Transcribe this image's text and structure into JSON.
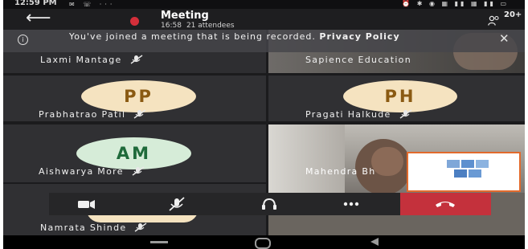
{
  "status_bar": {
    "time": "12:59 PM"
  },
  "header": {
    "title": "Meeting",
    "duration": "16:58",
    "attendees": "21 attendees",
    "participants_count": "20+"
  },
  "banner": {
    "text_prefix": "You've joined a meeting that is being recorded.",
    "link_label": "Privacy Policy"
  },
  "participants": [
    {
      "name": "Laxmi Mantage"
    },
    {
      "name": "Sapience Education"
    },
    {
      "name": "Prabhatrao Patil",
      "initials": "PP",
      "avatar_color": "#f5e3c0",
      "initials_color": "#8a5a12"
    },
    {
      "name": "Pragati Halkude",
      "initials": "PH",
      "avatar_color": "#f5e3c0",
      "initials_color": "#8a5a12"
    },
    {
      "name": "Aishwarya More",
      "initials": "AM",
      "avatar_color": "#d6ecd8",
      "initials_color": "#1f6a3a"
    },
    {
      "name": "Mahendra Bh"
    },
    {
      "name": "Namrata Shinde",
      "avatar_color": "#f5e3c0"
    }
  ],
  "colors": {
    "record": "#d42f3a",
    "hangup": "#c4313c",
    "background": "#1b1b1d",
    "tile": "#303033"
  },
  "icons": {
    "back": "back-arrow-icon",
    "people": "people-icon",
    "info": "info-icon",
    "close": "close-icon",
    "mic_off": "mic-off-icon",
    "camera": "camera-icon",
    "audio": "headset-icon",
    "more": "more-icon",
    "hangup": "hang-up-icon"
  }
}
